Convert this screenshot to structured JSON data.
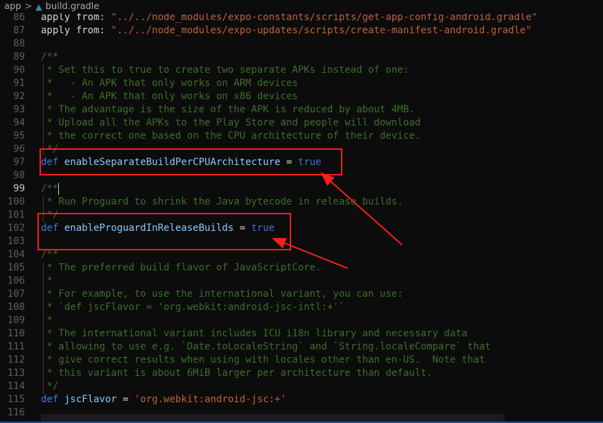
{
  "breadcrumb": {
    "folder": "app",
    "separator": ">",
    "file": "build.gradle",
    "file_icon": "gradle-elephant-icon"
  },
  "current_line": 99,
  "lines": [
    {
      "n": 86,
      "tokens": [
        [
          "plain",
          "apply from: "
        ],
        [
          "string",
          "\"../../node_modules/expo-constants/scripts/get-app-config-android.gradle\""
        ]
      ]
    },
    {
      "n": 87,
      "tokens": [
        [
          "plain",
          "apply from: "
        ],
        [
          "string",
          "\"../../node_modules/expo-updates/scripts/create-manifest-android.gradle\""
        ]
      ]
    },
    {
      "n": 88,
      "tokens": []
    },
    {
      "n": 89,
      "tokens": [
        [
          "comment",
          "/**"
        ]
      ]
    },
    {
      "n": 90,
      "tokens": [
        [
          "comment",
          " * Set this to true to create two separate APKs instead of one:"
        ]
      ]
    },
    {
      "n": 91,
      "tokens": [
        [
          "comment",
          " *   - An APK that only works on ARM devices"
        ]
      ]
    },
    {
      "n": 92,
      "tokens": [
        [
          "comment",
          " *   - An APK that only works on x86 devices"
        ]
      ]
    },
    {
      "n": 93,
      "tokens": [
        [
          "comment",
          " * The advantage is the size of the APK is reduced by about 4MB."
        ]
      ]
    },
    {
      "n": 94,
      "tokens": [
        [
          "comment",
          " * Upload all the APKs to the Play Store and people will download"
        ]
      ]
    },
    {
      "n": 95,
      "tokens": [
        [
          "comment",
          " * the correct one based on the CPU architecture of their device."
        ]
      ]
    },
    {
      "n": 96,
      "tokens": [
        [
          "comment",
          " */"
        ]
      ]
    },
    {
      "n": 97,
      "tokens": [
        [
          "keyword",
          "def"
        ],
        [
          "plain",
          " "
        ],
        [
          "ident",
          "enableSeparateBuildPerCPUArchitecture"
        ],
        [
          "op",
          " = "
        ],
        [
          "bool",
          "true"
        ]
      ]
    },
    {
      "n": 98,
      "tokens": []
    },
    {
      "n": 99,
      "tokens": [
        [
          "comment",
          "/**"
        ]
      ]
    },
    {
      "n": 100,
      "tokens": [
        [
          "comment",
          " * Run Proguard to shrink the Java bytecode in release builds."
        ]
      ]
    },
    {
      "n": 101,
      "tokens": [
        [
          "comment",
          " */"
        ]
      ]
    },
    {
      "n": 102,
      "tokens": [
        [
          "keyword",
          "def"
        ],
        [
          "plain",
          " "
        ],
        [
          "ident",
          "enableProguardInReleaseBuilds"
        ],
        [
          "op",
          " = "
        ],
        [
          "bool",
          "true"
        ]
      ]
    },
    {
      "n": 103,
      "tokens": []
    },
    {
      "n": 104,
      "tokens": [
        [
          "comment",
          "/**"
        ]
      ]
    },
    {
      "n": 105,
      "tokens": [
        [
          "comment",
          " * The preferred build flavor of JavaScriptCore."
        ]
      ]
    },
    {
      "n": 106,
      "tokens": [
        [
          "comment",
          " *"
        ]
      ]
    },
    {
      "n": 107,
      "tokens": [
        [
          "comment",
          " * For example, to use the international variant, you can use:"
        ]
      ]
    },
    {
      "n": 108,
      "tokens": [
        [
          "comment",
          " * `def jscFlavor = 'org.webkit:android-jsc-intl:+'`"
        ]
      ]
    },
    {
      "n": 109,
      "tokens": [
        [
          "comment",
          " *"
        ]
      ]
    },
    {
      "n": 110,
      "tokens": [
        [
          "comment",
          " * The international variant includes ICU i18n library and necessary data"
        ]
      ]
    },
    {
      "n": 111,
      "tokens": [
        [
          "comment",
          " * allowing to use e.g. `Date.toLocaleString` and `String.localeCompare` that"
        ]
      ]
    },
    {
      "n": 112,
      "tokens": [
        [
          "comment",
          " * give correct results when using with locales other than en-US.  Note that"
        ]
      ]
    },
    {
      "n": 113,
      "tokens": [
        [
          "comment",
          " * this variant is about 6MiB larger per architecture than default."
        ]
      ]
    },
    {
      "n": 114,
      "tokens": [
        [
          "comment",
          " */"
        ]
      ]
    },
    {
      "n": 115,
      "tokens": [
        [
          "keyword",
          "def"
        ],
        [
          "plain",
          " "
        ],
        [
          "ident",
          "jscFlavor"
        ],
        [
          "op",
          " = "
        ],
        [
          "string",
          "'org.webkit:android-jsc:+'"
        ]
      ]
    },
    {
      "n": 116,
      "tokens": []
    }
  ],
  "colors": {
    "annotation": "#ff1e1e",
    "background": "#0c0c0c"
  }
}
